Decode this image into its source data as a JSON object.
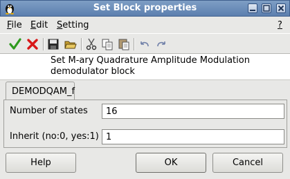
{
  "window": {
    "title": "Set Block properties"
  },
  "menubar": {
    "file": {
      "underline": "F",
      "rest": "ile"
    },
    "edit": {
      "underline": "E",
      "rest": "dit"
    },
    "setting": {
      "underline": "S",
      "rest": "etting"
    },
    "help": {
      "underline": "?"
    }
  },
  "toolbar": {
    "icons": [
      "check-icon",
      "cancel-x-icon",
      "save-icon",
      "open-folder-icon",
      "cut-icon",
      "copy-icon",
      "paste-icon",
      "undo-icon",
      "redo-icon"
    ]
  },
  "description": {
    "line1": "Set M-ary Quadrature Amplitude Modulation",
    "line2": "demodulator block"
  },
  "tabs": [
    {
      "label": "DEMODQAM_f"
    }
  ],
  "form": {
    "fields": [
      {
        "label": "Number of states",
        "value": "16"
      },
      {
        "label": "Inherit (no:0, yes:1)",
        "value": "1"
      }
    ]
  },
  "buttons": {
    "help": "Help",
    "ok": "OK",
    "cancel": "Cancel"
  },
  "colors": {
    "titlebar": "#6c8eba",
    "check_green": "#2e9a1e",
    "cancel_red": "#d81818"
  }
}
